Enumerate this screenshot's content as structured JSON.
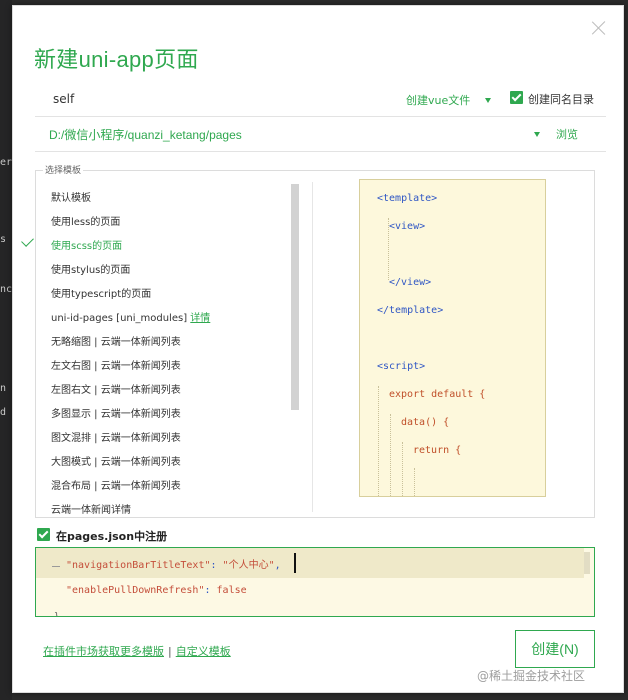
{
  "dialog": {
    "title": "新建uni-app页面",
    "name_value": "self",
    "vue_file_label": "创建vue文件",
    "same_dir_label": "创建同名目录",
    "path": "D:/微信小程序/quanzi_ketang/pages",
    "browse_label": "浏览",
    "template_legend": "选择模板",
    "templates": [
      {
        "label": "默认模板",
        "selected": false
      },
      {
        "label": "使用less的页面",
        "selected": false
      },
      {
        "label": "使用scss的页面",
        "selected": true
      },
      {
        "label": "使用stylus的页面",
        "selected": false
      },
      {
        "label": "使用typescript的页面",
        "selected": false
      },
      {
        "label": "uni-id-pages [uni_modules]",
        "selected": false,
        "link": "详情"
      },
      {
        "label": "无略缩图 | 云端一体新闻列表",
        "selected": false
      },
      {
        "label": "左文右图 | 云端一体新闻列表",
        "selected": false
      },
      {
        "label": "左图右文 | 云端一体新闻列表",
        "selected": false
      },
      {
        "label": "多图显示 | 云端一体新闻列表",
        "selected": false
      },
      {
        "label": "图文混排 | 云端一体新闻列表",
        "selected": false
      },
      {
        "label": "大图模式 | 云端一体新闻列表",
        "selected": false
      },
      {
        "label": "混合布局 | 云端一体新闻列表",
        "selected": false
      },
      {
        "label": "云端一体新闻详情",
        "selected": false
      }
    ],
    "preview_code": [
      "<template>",
      "<view>",
      "</view>",
      "</template>",
      "<script>",
      "export default {",
      "data() {",
      "return {"
    ],
    "register_label": "在pages.json中注册",
    "json_lines": {
      "line1_key": "\"navigationBarTitleText\"",
      "line1_value": "\"个人中心\"",
      "line2_key": "\"enablePullDownRefresh\"",
      "line2_value": "false",
      "bottom_mark": "}"
    },
    "plugin_market_link": "在插件市场获取更多模版",
    "separator": "|",
    "custom_template_link": "自定义模板",
    "create_button": "创建(N)"
  },
  "watermark": "@稀土掘金技术社区",
  "background_fragments": [
    "er",
    "s",
    "nc",
    "n",
    "d"
  ],
  "colors": {
    "accent": "#2fa84f",
    "preview_bg": "#fdf8dc"
  },
  "icons": [
    "close-icon",
    "dropdown-caret-icon",
    "checkbox-checked-icon",
    "check-mark-icon"
  ]
}
